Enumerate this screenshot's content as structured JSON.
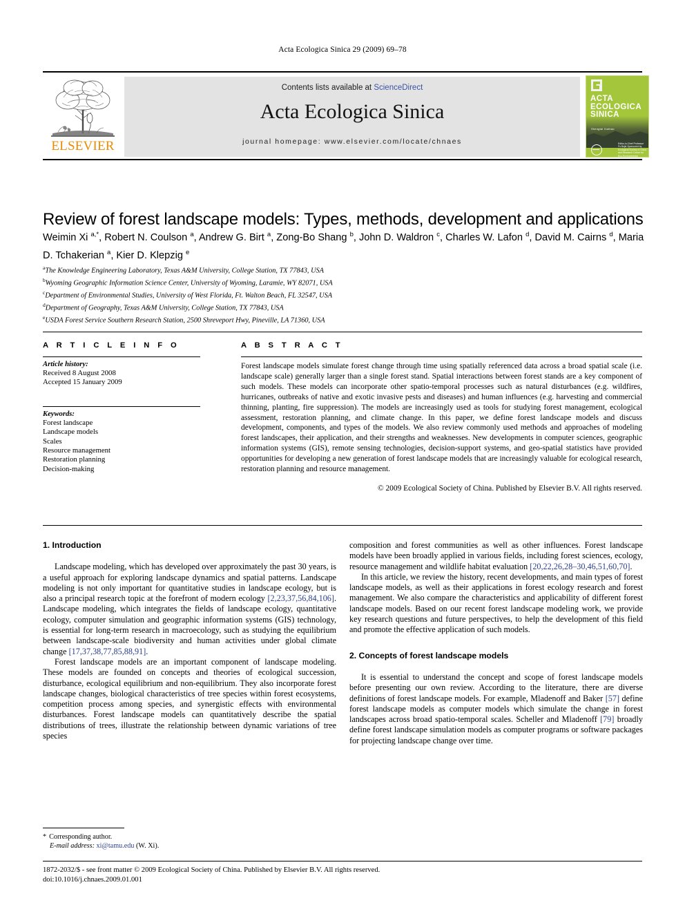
{
  "running_head": "Acta Ecologica Sinica 29 (2009) 69–78",
  "masthead": {
    "contents_prefix": "Contents lists available at ",
    "sciencedirect": "ScienceDirect",
    "journal_name": "Acta Ecologica Sinica",
    "homepage": "journal homepage: www.elsevier.com/locate/chnaes",
    "publisher_wordmark": "ELSEVIER",
    "cover": {
      "title_line1": "ACTA",
      "title_line2": "ECOLOGICA",
      "title_line3": "SINICA",
      "subtitle": "Shengtai Xuebao",
      "footer": "Editor-in-Chief Professor Fu Bojie Sponsored by Ecological Society of China and Research Center for Eco-Environmental Sciences, CAS"
    }
  },
  "article": {
    "title": "Review of forest landscape models: Types, methods, development and applications",
    "authors_html": "Weimin Xi <sup>a,</sup><sup>*</sup>, Robert N. Coulson <sup>a</sup>, Andrew G. Birt <sup>a</sup>, Zong-Bo Shang <sup>b</sup>, John D. Waldron <sup>c</sup>, Charles W. Lafon <sup>d</sup>, David M. Cairns <sup>d</sup>, Maria D. Tchakerian <sup>a</sup>, Kier D. Klepzig <sup>e</sup>",
    "affiliations": [
      {
        "marker": "a",
        "text": "The Knowledge Engineering Laboratory, Texas A&M University, College Station, TX 77843, USA"
      },
      {
        "marker": "b",
        "text": "Wyoming Geographic Information Science Center, University of Wyoming, Laramie, WY 82071, USA"
      },
      {
        "marker": "c",
        "text": "Department of Environmental Studies, University of West Florida, Ft. Walton Beach, FL 32547, USA"
      },
      {
        "marker": "d",
        "text": "Department of Geography, Texas A&M University, College Station, TX 77843, USA"
      },
      {
        "marker": "e",
        "text": "USDA Forest Service Southern Research Station, 2500 Shreveport Hwy, Pineville, LA 71360, USA"
      }
    ]
  },
  "article_info": {
    "heading": "A R T I C L E   I N F O",
    "history_label": "Article history:",
    "received": "Received 8 August 2008",
    "accepted": "Accepted 15 January 2009",
    "keywords_label": "Keywords:",
    "keywords": [
      "Forest landscape",
      "Landscape models",
      "Scales",
      "Resource management",
      "Restoration planning",
      "Decision-making"
    ]
  },
  "abstract": {
    "heading": "A B S T R A C T",
    "text": "Forest landscape models simulate forest change through time using spatially referenced data across a broad spatial scale (i.e. landscape scale) generally larger than a single forest stand. Spatial interactions between forest stands are a key component of such models. These models can incorporate other spatio-temporal processes such as natural disturbances (e.g. wildfires, hurricanes, outbreaks of native and exotic invasive pests and diseases) and human influences (e.g. harvesting and commercial thinning, planting, fire suppression). The models are increasingly used as tools for studying forest management, ecological assessment, restoration planning, and climate change. In this paper, we define forest landscape models and discuss development, components, and types of the models. We also review commonly used methods and approaches of modeling forest landscapes, their application, and their strengths and weaknesses. New developments in computer sciences, geographic information systems (GIS), remote sensing technologies, decision-support systems, and geo-spatial statistics have provided opportunities for developing a new generation of forest landscape models that are increasingly valuable for ecological research, restoration planning and resource management.",
    "copyright": "© 2009 Ecological Society of China. Published by Elsevier B.V. All rights reserved."
  },
  "body": {
    "section1_heading": "1. Introduction",
    "section2_heading": "2. Concepts of forest landscape models",
    "p1_a": "Landscape modeling, which has developed over approximately the past 30 years, is a useful approach for exploring landscape dynamics and spatial patterns. Landscape modeling is not only important for quantitative studies in landscape ecology, but is also a principal research topic at the forefront of modern ecology ",
    "p1_ref1": "[2,23,37,56,84,106]",
    "p1_b": ". Landscape modeling, which integrates the fields of landscape ecology, quantitative ecology, computer simulation and geographic information systems (GIS) technology, is essential for long-term research in macroecology, such as studying the equilibrium between landscape-scale biodiversity and human activities under global climate change ",
    "p1_ref2": "[17,37,38,77,85,88,91]",
    "p1_c": ".",
    "p2": "Forest landscape models are an important component of landscape modeling. These models are founded on concepts and theories of ecological succession, disturbance, ecological equilibrium and non-equilibrium. They also incorporate forest landscape changes, biological characteristics of tree species within forest ecosystems, competition process among species, and synergistic effects with environmental disturbances. Forest landscape models can quantitatively describe the spatial distributions of trees, illustrate the relationship between dynamic variations of tree species",
    "p3_a": "composition and forest communities as well as other influences. Forest landscape models have been broadly applied in various fields, including forest sciences, ecology, resource management and wildlife habitat evaluation ",
    "p3_ref": "[20,22,26,28–30,46,51,60,70]",
    "p3_b": ".",
    "p4": "In this article, we review the history, recent developments, and main types of forest landscape models, as well as their applications in forest ecology research and forest management. We also compare the characteristics and applicability of different forest landscape models. Based on our recent forest landscape modeling work, we provide key research questions and future perspectives, to help the development of this field and promote the effective application of such models.",
    "p5_a": "It is essential to understand the concept and scope of forest landscape models before presenting our own review. According to the literature, there are diverse definitions of forest landscape models. For example, Mladenoff and Baker ",
    "p5_ref1": "[57]",
    "p5_b": " define forest landscape models as computer models which simulate the change in forest landscapes across broad spatio-temporal scales. Scheller and Mladenoff ",
    "p5_ref2": "[79]",
    "p5_c": " broadly define forest landscape simulation models as computer programs or software packages for projecting landscape change over time."
  },
  "footnote": {
    "star": "*",
    "corresponding": "Corresponding author.",
    "email_label": "E-mail address:",
    "email": "xi@tamu.edu",
    "email_owner": "(W. Xi)."
  },
  "page_footer": {
    "line1": "1872-2032/$ - see front matter © 2009 Ecological Society of China. Published by Elsevier B.V. All rights reserved.",
    "line2": "doi:10.1016/j.chnaes.2009.01.001"
  },
  "colors": {
    "elsevier_orange": "#ED8B00",
    "link_blue": "#3a53a4",
    "reference_blue": "#2b3f8c",
    "masthead_grey": "#e3e3e3",
    "cover_green": "#a3c63b"
  }
}
